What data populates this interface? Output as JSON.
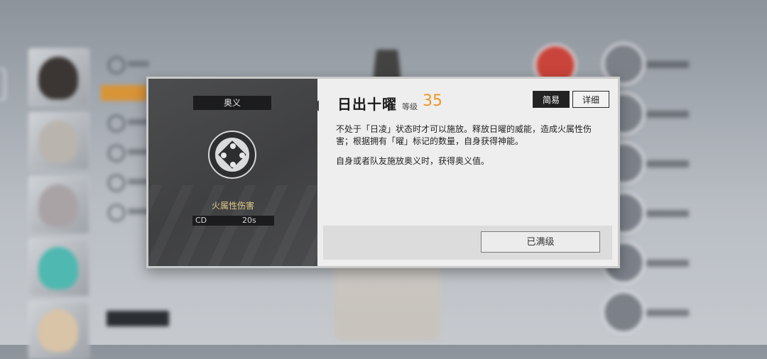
{
  "dialog": {
    "left": {
      "tag": "奥义",
      "damage_type": "火属性伤害",
      "cd_label": "CD",
      "cd_value": "20s"
    },
    "right": {
      "skill_name": "日出十曜",
      "level_label": "等级",
      "level_value": "35",
      "mode_simple": "简易",
      "mode_detail": "详细",
      "description_1": "不处于「日凌」状态时才可以施放。释放日曜的威能，造成火属性伤害；根据拥有「曜」标记的数量，自身获得神能。",
      "description_2": "自身或者队友施放奥义时，获得奥义值。",
      "max_level_button": "已满级"
    }
  },
  "colors": {
    "accent_level": "#f0962a",
    "damage_type": "#e3c98a",
    "menu_active": "#d99437"
  },
  "icons": [
    "skill-emblem-icon",
    "pointer-arrow-icon"
  ]
}
